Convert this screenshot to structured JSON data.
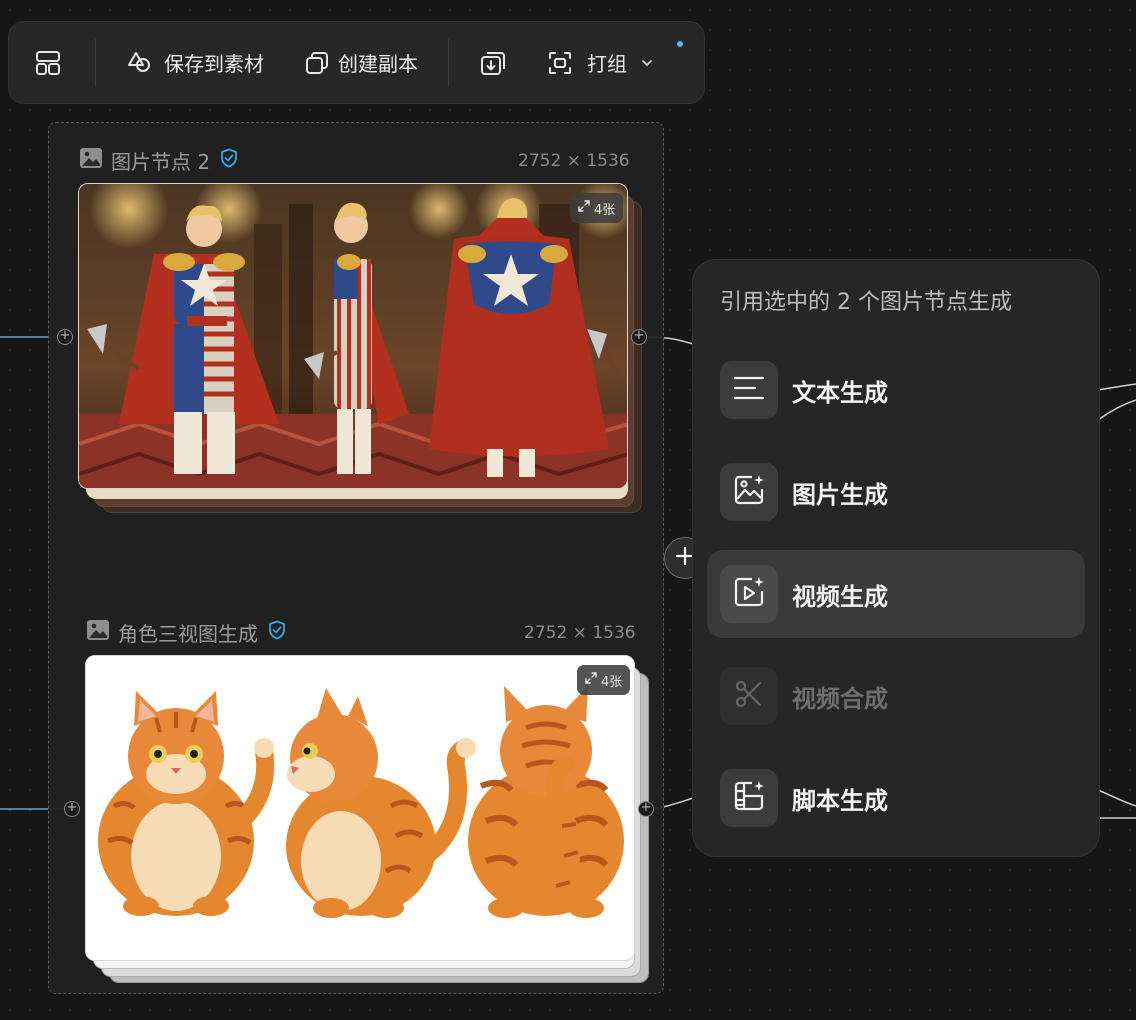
{
  "toolbar": {
    "layout_icon": "layout-icon",
    "save_to_assets_label": "保存到素材",
    "create_copy_label": "创建副本",
    "export_icon": "download-icon",
    "group_label": "打组",
    "colors": {
      "background": "#272727",
      "notification_dot": "#4ab8ff"
    }
  },
  "nodes": [
    {
      "title": "图片节点 2",
      "dimensions": "2752 × 1536",
      "badge": "4张",
      "verified": true,
      "image_subject": "three-view character sheet of a superhero in a stars-and-stripes costume with red cape"
    },
    {
      "title": "角色三视图生成",
      "dimensions": "2752 × 1536",
      "badge": "4张",
      "verified": true,
      "image_subject": "three-view character sheet of a fat orange tabby cat"
    }
  ],
  "panel": {
    "title": "引用选中的 2 个图片节点生成",
    "items": [
      {
        "label": "文本生成",
        "icon": "text-lines-icon",
        "state": "normal"
      },
      {
        "label": "图片生成",
        "icon": "image-sparkle-icon",
        "state": "normal"
      },
      {
        "label": "视频生成",
        "icon": "video-sparkle-icon",
        "state": "active"
      },
      {
        "label": "视频合成",
        "icon": "scissors-icon",
        "state": "disabled"
      },
      {
        "label": "脚本生成",
        "icon": "storyboard-sparkle-icon",
        "state": "normal"
      }
    ],
    "colors": {
      "background": "#262626",
      "active_item": "#3a3a3a",
      "accent": "#39a6e6"
    }
  }
}
